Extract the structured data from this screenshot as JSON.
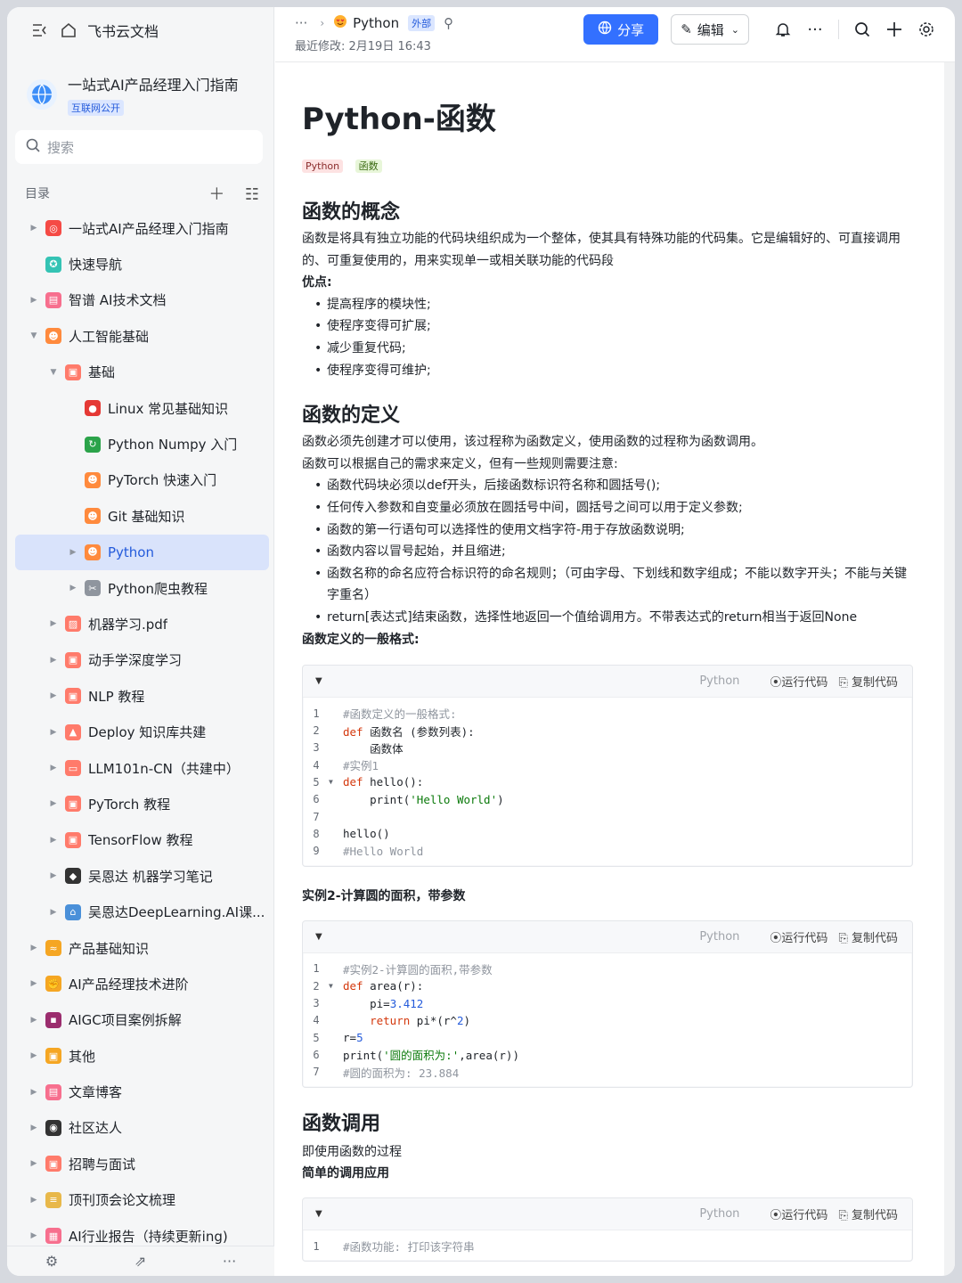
{
  "sidebar": {
    "app_name": "飞书云文档",
    "space_title": "一站式AI产品经理入门指南",
    "space_badge": "互联网公开",
    "search_placeholder": "搜索",
    "toc_label": "目录",
    "items": [
      {
        "label": "一站式AI产品经理入门指南",
        "icon": "target-icon",
        "color": "#f54a45",
        "level": 0,
        "arrow": true
      },
      {
        "label": "快速导航",
        "icon": "compass-icon",
        "color": "#34c3b4",
        "level": 0,
        "arrow": false
      },
      {
        "label": "智谱 AI技术文档",
        "icon": "doc-icon",
        "color": "#f76f8e",
        "level": 0,
        "arrow": true
      },
      {
        "label": "人工智能基础",
        "icon": "heart-eyes-icon",
        "color": "#ff8a3d",
        "level": 0,
        "arrow": true,
        "open": true
      },
      {
        "label": "基础",
        "icon": "folder-icon",
        "color": "#ff7b6b",
        "level": 1,
        "arrow": true,
        "open": true
      },
      {
        "label": "Linux 常见基础知识",
        "icon": "apple-icon",
        "color": "#e53935",
        "level": 2,
        "arrow": false
      },
      {
        "label": "Python Numpy 入门",
        "icon": "refresh-icon",
        "color": "#2ba34a",
        "level": 2,
        "arrow": false
      },
      {
        "label": "PyTorch 快速入门",
        "icon": "heart-eyes-icon",
        "color": "#ff8a3d",
        "level": 2,
        "arrow": false
      },
      {
        "label": "Git 基础知识",
        "icon": "heart-eyes-icon",
        "color": "#ff8a3d",
        "level": 2,
        "arrow": false
      },
      {
        "label": "Python",
        "icon": "heart-eyes-icon",
        "color": "#ff8a3d",
        "level": 2,
        "arrow": true,
        "active": true
      },
      {
        "label": "Python爬虫教程",
        "icon": "tools-icon",
        "color": "#8f959e",
        "level": 2,
        "arrow": true
      },
      {
        "label": "机器学习.pdf",
        "icon": "image-icon",
        "color": "#ff7b6b",
        "level": 1,
        "arrow": true
      },
      {
        "label": "动手学深度学习",
        "icon": "folder-icon",
        "color": "#ff7b6b",
        "level": 1,
        "arrow": true
      },
      {
        "label": "NLP 教程",
        "icon": "folder-icon",
        "color": "#ff7b6b",
        "level": 1,
        "arrow": true
      },
      {
        "label": "Deploy 知识库共建",
        "icon": "chart-icon",
        "color": "#ff7b6b",
        "level": 1,
        "arrow": true
      },
      {
        "label": "LLM101n-CN（共建中）",
        "icon": "board-icon",
        "color": "#ff7b6b",
        "level": 1,
        "arrow": true
      },
      {
        "label": "PyTorch 教程",
        "icon": "folder-icon",
        "color": "#ff7b6b",
        "level": 1,
        "arrow": true
      },
      {
        "label": "TensorFlow 教程",
        "icon": "folder-icon",
        "color": "#ff7b6b",
        "level": 1,
        "arrow": true
      },
      {
        "label": "吴恩达 机器学习笔记",
        "icon": "grad-cap-icon",
        "color": "#333333",
        "level": 1,
        "arrow": true
      },
      {
        "label": "吴恩达DeepLearning.AI课...",
        "icon": "building-icon",
        "color": "#4a90d9",
        "level": 1,
        "arrow": true
      },
      {
        "label": "产品基础知识",
        "icon": "wave-icon",
        "color": "#f5a623",
        "level": 0,
        "arrow": true
      },
      {
        "label": "AI产品经理技术进阶",
        "icon": "muscle-icon",
        "color": "#f5a623",
        "level": 0,
        "arrow": true
      },
      {
        "label": "AIGC项目案例拆解",
        "icon": "save-icon",
        "color": "#9b2d6e",
        "level": 0,
        "arrow": true
      },
      {
        "label": "其他",
        "icon": "folder-icon",
        "color": "#f5a623",
        "level": 0,
        "arrow": true
      },
      {
        "label": "文章博客",
        "icon": "doc-icon",
        "color": "#f76f8e",
        "level": 0,
        "arrow": true
      },
      {
        "label": "社区达人",
        "icon": "eyes-icon",
        "color": "#333333",
        "level": 0,
        "arrow": true
      },
      {
        "label": "招聘与面试",
        "icon": "folder-icon",
        "color": "#ff7b6b",
        "level": 0,
        "arrow": true
      },
      {
        "label": "顶刊顶会论文梳理",
        "icon": "scroll-icon",
        "color": "#e8b84a",
        "level": 0,
        "arrow": true
      },
      {
        "label": "AI行业报告（持续更新ing)",
        "icon": "grid-icon",
        "color": "#f76f8e",
        "level": 0,
        "arrow": true
      }
    ]
  },
  "topbar": {
    "breadcrumb_more": "···",
    "doc_name": "Python",
    "external_tag": "外部",
    "last_modified": "最近修改: 2月19日 16:43",
    "share_label": "分享",
    "edit_label": "编辑"
  },
  "doc": {
    "title": "Python-函数",
    "tags": [
      "Python",
      "函数"
    ],
    "s1_title": "函数的概念",
    "s1_p1": "函数是将具有独立功能的代码块组织成为一个整体，使其具有特殊功能的代码集。它是编辑好的、可直接调用的、可重复使用的，用来实现单一或相关联功能的代码段",
    "s1_adv": "优点:",
    "s1_list": [
      "提高程序的模块性;",
      "使程序变得可扩展;",
      "减少重复代码;",
      "使程序变得可维护;"
    ],
    "s2_title": "函数的定义",
    "s2_p1": "函数必须先创建才可以使用，该过程称为函数定义，使用函数的过程称为函数调用。",
    "s2_p2": "函数可以根据自己的需求来定义，但有一些规则需要注意:",
    "s2_list": [
      "函数代码块必须以def开头，后接函数标识符名称和圆括号();",
      "任何传入参数和自变量必须放在圆括号中间，圆括号之间可以用于定义参数;",
      "函数的第一行语句可以选择性的使用文档字符-用于存放函数说明;",
      "函数内容以冒号起始，并且缩进;",
      "函数名称的命名应符合标识符的命名规则；（可由字母、下划线和数字组成；不能以数字开头；不能与关键字重名）",
      "return[表达式]结束函数，选择性地返回一个值给调用方。不带表达式的return相当于返回None"
    ],
    "s2_format": "函数定义的一般格式:",
    "code_lang": "Python",
    "run_label": "运行代码",
    "copy_label": "复制代码",
    "code1_lines": [
      "#函数定义的一般格式:",
      "def 函数名 (参数列表):",
      "    函数体",
      "#实例1",
      "def hello():",
      "    print('Hello World')",
      "",
      "hello()",
      "#Hello World"
    ],
    "ex2_title": "实例2-计算圆的面积，带参数",
    "code2_lines": [
      "#实例2-计算圆的面积,带参数",
      "def area(r):",
      "    pi=3.412",
      "    return pi*(r^2)",
      "r=5",
      "print('圆的面积为:',area(r))",
      "#圆的面积为: 23.884"
    ],
    "s3_title": "函数调用",
    "s3_p1": "即使用函数的过程",
    "s3_sub": "简单的调用应用",
    "code3_lines": [
      "#函数功能: 打印该字符串"
    ]
  }
}
